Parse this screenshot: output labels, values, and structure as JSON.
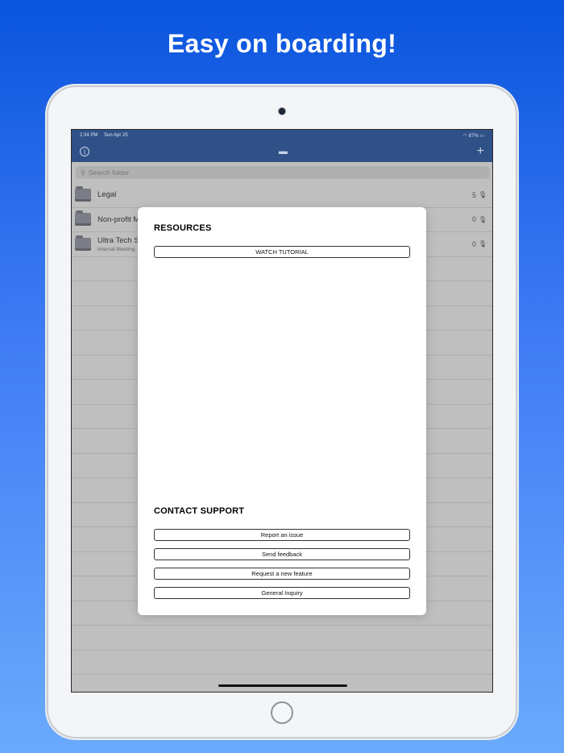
{
  "headline": "Easy on boarding!",
  "status_bar": {
    "time": "2:34 PM",
    "date": "Sun Apr 25",
    "battery": "87%"
  },
  "nav": {
    "info_glyph": "i",
    "folder_glyph": "▬",
    "plus_glyph": "+"
  },
  "search": {
    "placeholder": "Search folder",
    "icon": "magnifier-icon"
  },
  "folders": [
    {
      "name": "Legal",
      "subtitle": "",
      "count": "5"
    },
    {
      "name": "Non-profit M",
      "subtitle": "",
      "count": "0"
    },
    {
      "name": "Ultra Tech St",
      "subtitle": "Internal Meeting",
      "count": "0"
    }
  ],
  "modal": {
    "resources_title": "RESOURCES",
    "watch_tutorial": "WATCH TUTORIAL",
    "contact_title": "CONTACT SUPPORT",
    "buttons": [
      "Report an issue",
      "Send feedback",
      "Request a new feature",
      "General Inquiry"
    ]
  },
  "colors": {
    "nav_bar": "#2f5187",
    "background_top": "#0a55dd",
    "background_bottom": "#6aaafc"
  }
}
